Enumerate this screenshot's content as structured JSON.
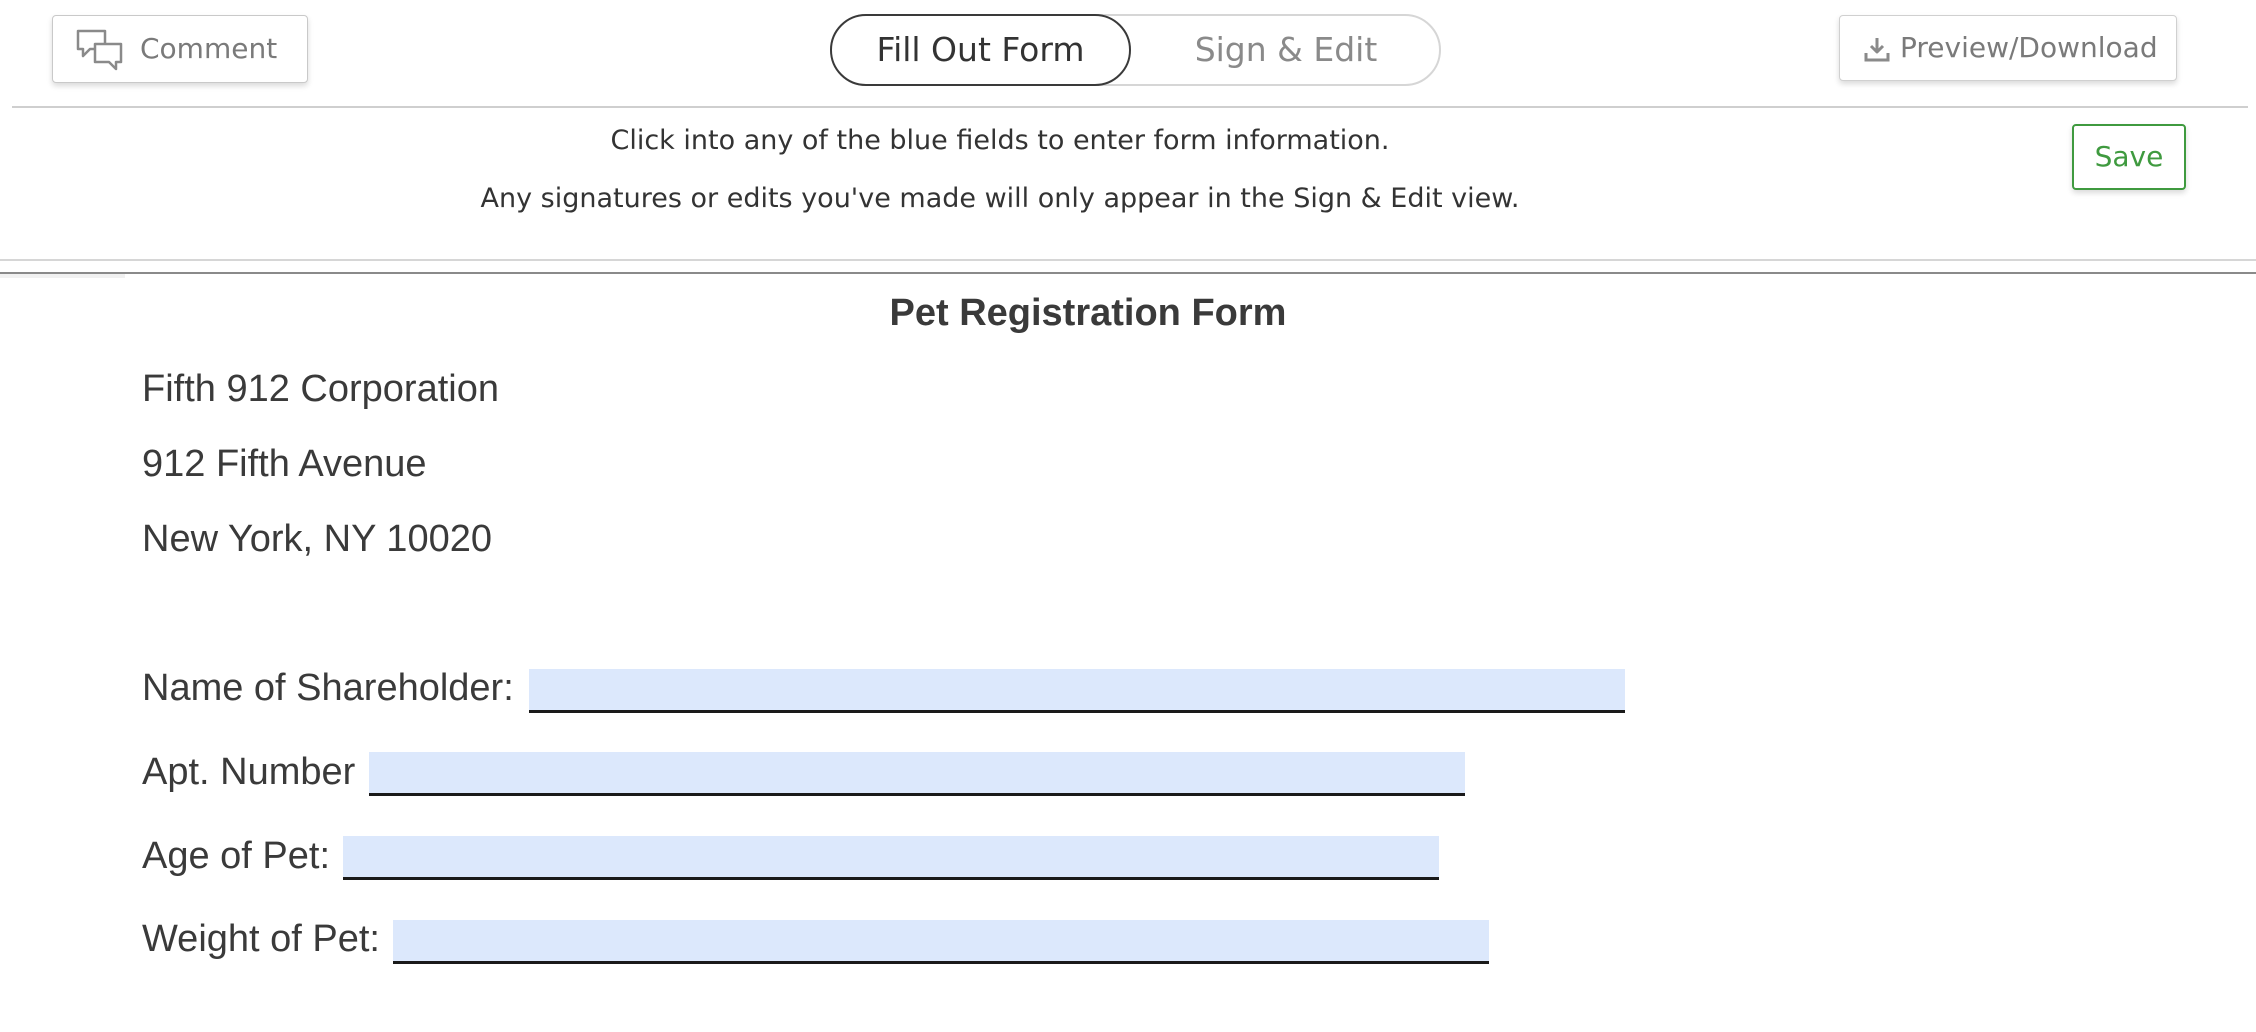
{
  "toolbar": {
    "comment_label": "Comment",
    "mode_active": "Fill Out Form",
    "mode_inactive": "Sign & Edit",
    "preview_label": "Preview/Download"
  },
  "info": {
    "line1": "Click into any of the blue fields to enter form information.",
    "line2": "Any signatures or edits you've made will only appear in the Sign & Edit view.",
    "save_label": "Save"
  },
  "document": {
    "title": "Pet Registration Form",
    "address": [
      "Fifth 912 Corporation",
      "912 Fifth Avenue",
      "New York, NY 10020"
    ],
    "fields": [
      {
        "label": "Name of Shareholder:",
        "value": ""
      },
      {
        "label": "Apt. Number",
        "value": ""
      },
      {
        "label": "Age of Pet:",
        "value": ""
      },
      {
        "label": "Weight of Pet:",
        "value": ""
      }
    ]
  },
  "colors": {
    "field_fill": "#dce8fc",
    "save_accent": "#3f9a3f"
  },
  "icons": {
    "comment": "speech-bubbles-icon",
    "preview": "download-icon"
  }
}
